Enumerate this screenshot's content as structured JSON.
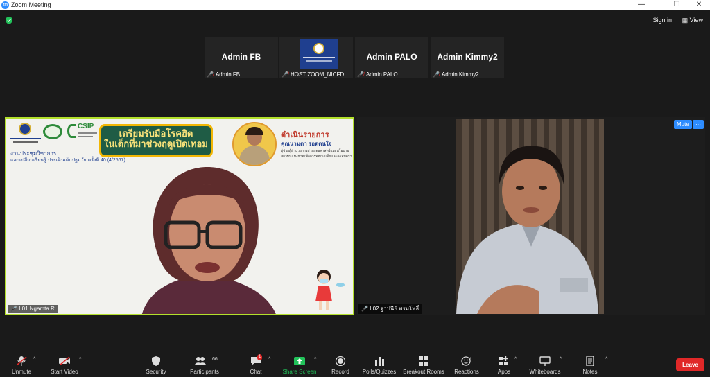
{
  "window": {
    "title": "Zoom Meeting",
    "app_badge": "zoom"
  },
  "topbar": {
    "sign_in": "Sign in",
    "view": "View"
  },
  "participants_strip": [
    {
      "display": "Admin FB",
      "label": "Admin FB",
      "muted": true,
      "type": "text"
    },
    {
      "display": "",
      "label": "HOST ZOOM_NICFD",
      "muted": true,
      "type": "logo"
    },
    {
      "display": "Admin PALO",
      "label": "Admin PALO",
      "muted": true,
      "type": "text"
    },
    {
      "display": "Admin Kimmy2",
      "label": "Admin Kimmy2",
      "muted": true,
      "type": "text"
    }
  ],
  "slide": {
    "csip": "CSIP",
    "banner_line1": "เตรียมรับมือโรคฮิต",
    "banner_line2": "ในเด็กที่มาช่วงฤดูเปิดเทอม",
    "moderator_title": "ดำเนินรายการ",
    "moderator_name": "คุณนามตา รอดตนใจ",
    "moderator_role1": "ผู้ช่วยผู้อำนวยการฝ่ายยุทธศาสตร์และนโยบาย",
    "moderator_role2": "สถาบันแห่งชาติเพื่อการพัฒนาเด็กและครอบครัว",
    "event_line1": "งานประชุมวิชาการ",
    "event_line2": "แลกเปลี่ยนเรียนรู้ ประเด็นเด็กปฐมวัย ครั้งที่ 40 (4/2567)"
  },
  "video_tiles": [
    {
      "name": "L01 Ngamta R"
    },
    {
      "name": "L02 ฐาปนีย์ พรมโพธิ์"
    }
  ],
  "tile_controls": {
    "mute": "Mute",
    "more": "···"
  },
  "toolbar": {
    "unmute": "Unmute",
    "start_video": "Start Video",
    "security": "Security",
    "participants": "Participants",
    "participants_count": "66",
    "chat": "Chat",
    "chat_badge": "1",
    "share_screen": "Share Screen",
    "record": "Record",
    "polls": "Polls/Quizzes",
    "breakout": "Breakout Rooms",
    "reactions": "Reactions",
    "apps": "Apps",
    "whiteboards": "Whiteboards",
    "notes": "Notes",
    "leave": "Leave"
  },
  "colors": {
    "accent": "#2d8cff",
    "leave": "#e02828",
    "share": "#22c25a",
    "active_border": "#b3e02c"
  }
}
